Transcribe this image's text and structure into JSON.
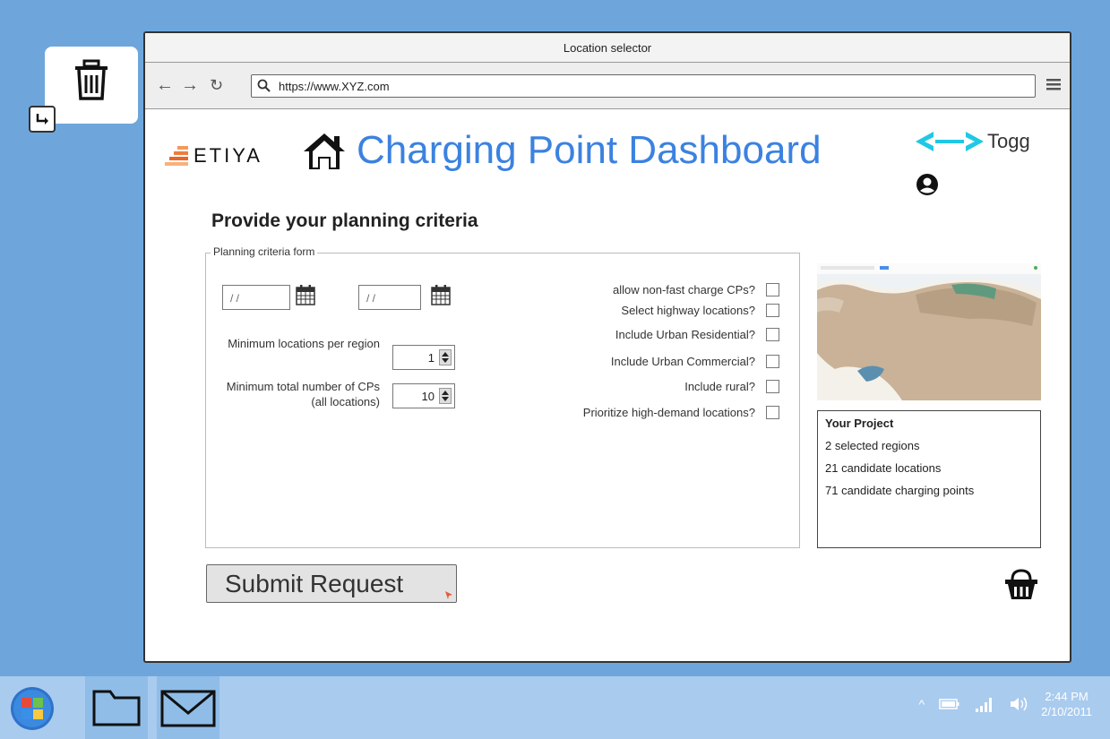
{
  "window": {
    "title": "Location selector",
    "url": "https://www.XYZ.com"
  },
  "header": {
    "brand_left": "ETIYA",
    "title": "Charging Point Dashboard",
    "brand_right": "Togg"
  },
  "form": {
    "heading": "Provide your planning criteria",
    "legend": "Planning criteria form",
    "date_from_placeholder": "/ /",
    "date_to_placeholder": "/ /",
    "min_locations_label": "Minimum locations per region",
    "min_locations_value": "1",
    "min_total_label": "Minimum total number of CPs (all locations)",
    "min_total_value": "10",
    "checkboxes": [
      {
        "label": "allow non-fast charge CPs?",
        "checked": false
      },
      {
        "label": "Select highway locations?",
        "checked": false
      },
      {
        "label": "Include Urban Residential?",
        "checked": false
      },
      {
        "label": "Include Urban Commercial?",
        "checked": false
      },
      {
        "label": "Include rural?",
        "checked": false
      },
      {
        "label": "Prioritize high-demand locations?",
        "checked": false
      }
    ],
    "submit_label": "Submit Request"
  },
  "project": {
    "title": "Your Project",
    "lines": [
      "2 selected regions",
      "21 candidate locations",
      "71 candidate charging points"
    ]
  },
  "taskbar": {
    "time": "2:44 PM",
    "date": "2/10/2011"
  }
}
